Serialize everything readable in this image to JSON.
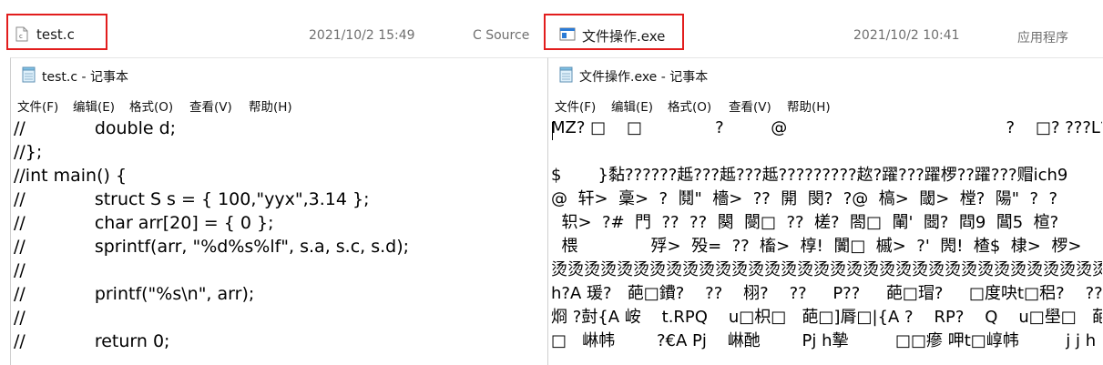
{
  "explorer": {
    "file1": {
      "name": "test.c",
      "date": "2021/10/2 15:49",
      "type": "C Source",
      "icon": "c-source-file-icon"
    },
    "file2": {
      "name": "文件操作.exe",
      "date": "2021/10/2 10:41",
      "type": "应用程序",
      "icon": "exe-file-icon"
    },
    "highlight_color": "#e21d1d"
  },
  "left_window": {
    "title": "test.c - 记事本",
    "icon": "notepad-icon",
    "menu": [
      "文件(F)",
      "编辑(E)",
      "格式(O)",
      "查看(V)",
      "帮助(H)"
    ],
    "lines": [
      {
        "prefix": "//",
        "code": "double d;"
      },
      {
        "prefix": "//};",
        "code": ""
      },
      {
        "prefix": "//int main() {",
        "code": ""
      },
      {
        "prefix": "//",
        "code": "struct S s = { 100,\"yyx\",3.14 };"
      },
      {
        "prefix": "//",
        "code": "char arr[20] = { 0 };"
      },
      {
        "prefix": "//",
        "code": "sprintf(arr, \"%d%s%lf\", s.a, s.c, s.d);"
      },
      {
        "prefix": "//",
        "code": ""
      },
      {
        "prefix": "//",
        "code": "printf(\"%s\\n\", arr);"
      },
      {
        "prefix": "//",
        "code": ""
      },
      {
        "prefix": "//",
        "code": "return 0;"
      }
    ]
  },
  "right_window": {
    "title": "文件操作.exe - 记事本",
    "icon": "notepad-icon",
    "menu": [
      "文件(F)",
      "编辑(E)",
      "格式(O)",
      "查看(V)",
      "帮助(H)"
    ],
    "lines": [
      "MZ? □    □              ?         @                                          ?    □? ???L?This",
      "",
      "$       }黏??????趆???趆???趆?????????趑?躍???躍椤??躍???赗ich9",
      "@  轩>  稾>  ?  鬩\"  檣>  ??  開  閔?  ?@  槁>  閾>  樘?  陽\"  ?  ?",
      "  轵>  ?#  門  ??  ??  闋  閿□  ??  槎?  閤□  閳'  閸?  閰9  閶5  楦?",
      "  椳              殍>  殁=  ??  槒>  椁!  闠□  槭>  ?'  閌!  楂$  棣>  椤>",
      "烫烫烫烫烫烫烫烫烫烫烫烫烫烫烫烫烫烫烫烫烫烫烫烫烫烫烫烫烫烫烫烫烫烫",
      "h?A 瑗?   葩□鐨?    ??    栩?    ??     P??     葩□瑁?     □度吷t□稆?    ??",
      "烱 ?尌{A 峖    t.RPQ    u□枳□   葩□]脣□|{A ?    RP?    Q    u□壆□   葩□",
      "□   崊帏        ?€A Pj    崊酏        Pj h摰         □□瘮 呷t□崞帏         j j h"
    ]
  }
}
